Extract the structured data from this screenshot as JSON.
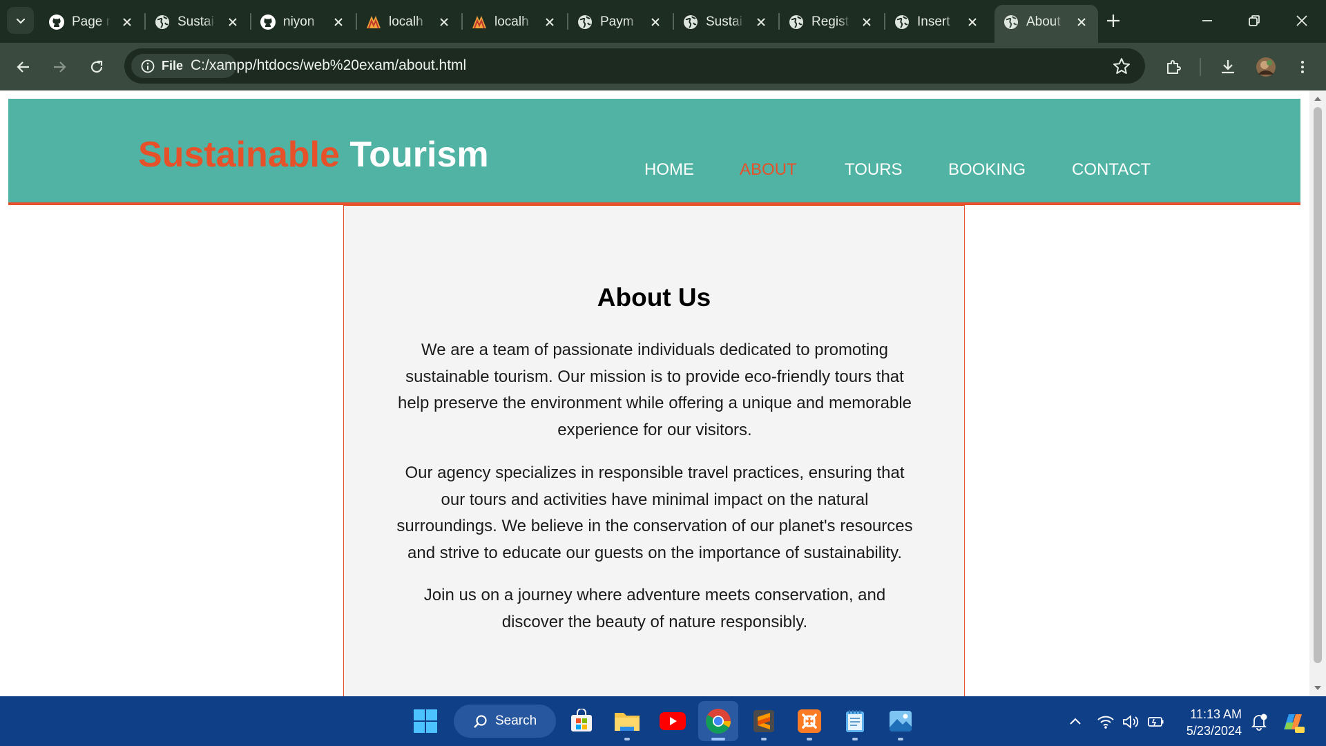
{
  "browser": {
    "tabs": [
      {
        "title": "Page r",
        "icon": "github-icon"
      },
      {
        "title": "Sustai",
        "icon": "globe-icon"
      },
      {
        "title": "niyon",
        "icon": "github-icon"
      },
      {
        "title": "localh",
        "icon": "xampp-icon"
      },
      {
        "title": "localh",
        "icon": "xampp-icon"
      },
      {
        "title": "Paym",
        "icon": "globe-icon"
      },
      {
        "title": "Sustai",
        "icon": "globe-icon"
      },
      {
        "title": "Regist",
        "icon": "globe-icon"
      },
      {
        "title": "Insert",
        "icon": "globe-icon"
      },
      {
        "title": "About",
        "icon": "globe-icon",
        "active": true
      }
    ],
    "site_chip_label": "File",
    "url": "C:/xampp/htdocs/web%20exam/about.html"
  },
  "site": {
    "logo_accent": "Sustainable",
    "logo_main": "Tourism",
    "nav": [
      {
        "label": "HOME"
      },
      {
        "label": "ABOUT",
        "active": true
      },
      {
        "label": "TOURS"
      },
      {
        "label": "BOOKING"
      },
      {
        "label": "CONTACT"
      }
    ],
    "colors": {
      "header_bg": "#50b3a3",
      "accent": "#e6512a",
      "content_bg": "#f4f4f4"
    }
  },
  "about": {
    "title": "About Us",
    "paragraphs": [
      "We are a team of passionate individuals dedicated to promoting sustainable tourism. Our mission is to provide eco-friendly tours that help preserve the environment while offering a unique and memorable experience for our visitors.",
      "Our agency specializes in responsible travel practices, ensuring that our tours and activities have minimal impact on the natural surroundings. We believe in the conservation of our planet's resources and strive to educate our guests on the importance of sustainability.",
      "Join us on a journey where adventure meets conservation, and discover the beauty of nature responsibly."
    ]
  },
  "taskbar": {
    "search_label": "Search",
    "apps": [
      "windows-start-icon",
      "microsoft-store-icon",
      "file-explorer-icon",
      "youtube-icon",
      "chrome-icon",
      "sublime-text-icon",
      "xampp-icon",
      "notepad-icon",
      "photos-icon"
    ],
    "time": "11:13 AM",
    "date": "5/23/2024"
  }
}
